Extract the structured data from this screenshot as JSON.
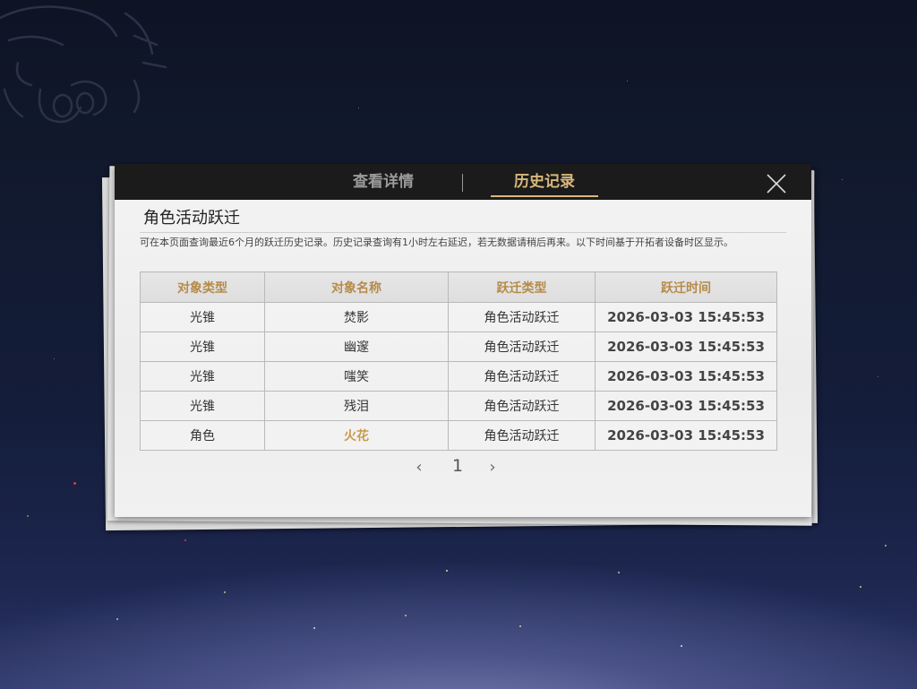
{
  "tabs": [
    {
      "label": "查看详情",
      "active": false
    },
    {
      "label": "历史记录",
      "active": true
    }
  ],
  "title": "角色活动跃迁",
  "description": "可在本页面查询最近6个月的跃迁历史记录。历史记录查询有1小时左右延迟，若无数据请稍后再来。以下时间基于开拓者设备时区显示。",
  "table": {
    "headers": [
      "对象类型",
      "对象名称",
      "跃迁类型",
      "跃迁时间"
    ],
    "rows": [
      [
        "光锥",
        "焚影",
        "角色活动跃迁",
        "2026-03-03 15:45:53"
      ],
      [
        "光锥",
        "幽邃",
        "角色活动跃迁",
        "2026-03-03 15:45:53"
      ],
      [
        "光锥",
        "嗤笑",
        "角色活动跃迁",
        "2026-03-03 15:45:53"
      ],
      [
        "光锥",
        "残泪",
        "角色活动跃迁",
        "2026-03-03 15:45:53"
      ],
      [
        "角色",
        "火花",
        "角色活动跃迁",
        "2026-03-03 15:45:53"
      ]
    ]
  },
  "pagination": {
    "current": "1",
    "prev_icon": "chevron-left-icon",
    "next_icon": "chevron-right-icon"
  },
  "colors": {
    "accent_gold": "#d8b77c",
    "header_text": "#b58b4a",
    "highlight_name": "#c99a4b",
    "topbar": "#1b1b1b"
  }
}
